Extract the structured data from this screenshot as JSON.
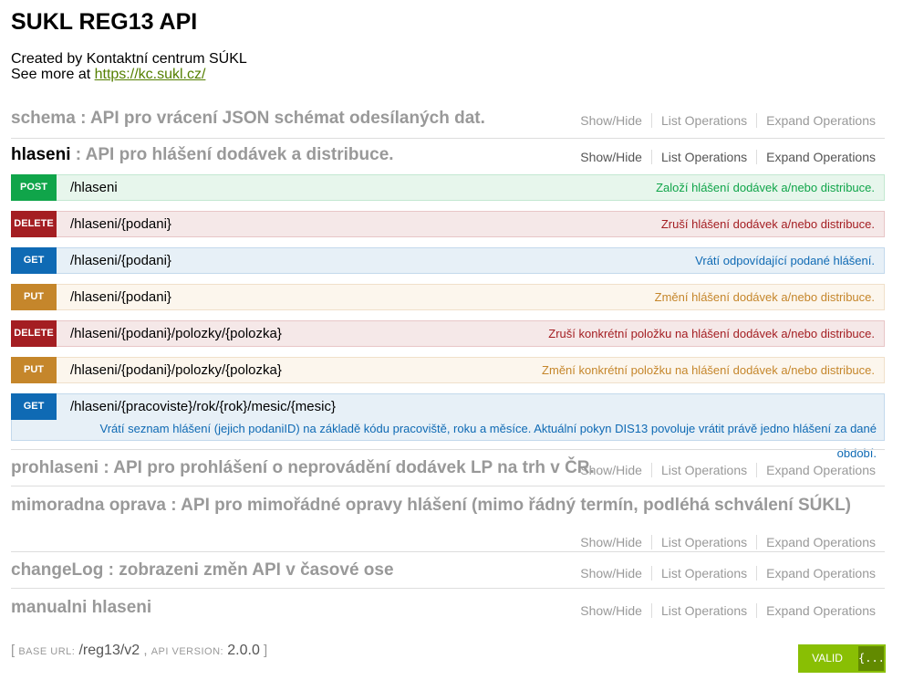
{
  "title": "SUKL REG13 API",
  "info": {
    "created_by": "Created by Kontaktní centrum SÚKL",
    "see_more_prefix": "See more at ",
    "link_text": "https://kc.sukl.cz/"
  },
  "ops_labels": {
    "show_hide": "Show/Hide",
    "list": "List Operations",
    "expand": "Expand Operations"
  },
  "resources": {
    "schema": {
      "name": "schema",
      "desc": ": API pro vrácení JSON schémat odesílaných dat."
    },
    "hlaseni": {
      "name": "hlaseni",
      "desc": ": API pro hlášení dodávek a distribuce."
    },
    "prohlaseni": {
      "name": "prohlaseni",
      "desc": ": API pro prohlášení o neprovádění dodávek LP na trh v ČR."
    },
    "mimoradna": {
      "name": "mimoradna oprava",
      "desc": ": API pro mimořádné opravy hlášení (mimo řádný termín, podléhá schválení SÚKL)"
    },
    "changelog": {
      "name": "changeLog",
      "desc": ": zobrazeni změn API v časové ose"
    },
    "manualni": {
      "name": "manualni hlaseni",
      "desc": ""
    }
  },
  "endpoints": [
    {
      "method": "POST",
      "path": "/hlaseni",
      "summary": "Založí hlášení dodávek a/nebo distribuce."
    },
    {
      "method": "DELETE",
      "path": "/hlaseni/{podani}",
      "summary": "Zruší hlášení dodávek a/nebo distribuce."
    },
    {
      "method": "GET",
      "path": "/hlaseni/{podani}",
      "summary": "Vrátí odpovídající podané hlášení."
    },
    {
      "method": "PUT",
      "path": "/hlaseni/{podani}",
      "summary": "Změní hlášení dodávek a/nebo distribuce."
    },
    {
      "method": "DELETE",
      "path": "/hlaseni/{podani}/polozky/{polozka}",
      "summary": "Zruší konkrétní položku na hlášení dodávek a/nebo distribuce."
    },
    {
      "method": "PUT",
      "path": "/hlaseni/{podani}/polozky/{polozka}",
      "summary": "Změní konkrétní položku na hlášení dodávek a/nebo distribuce."
    },
    {
      "method": "GET",
      "path": "/hlaseni/{pracoviste}/rok/{rok}/mesic/{mesic}",
      "summary": "Vrátí seznam hlášení (jejich podaniID) na základě kódu pracoviště, roku a měsíce. Aktuální pokyn DIS13 povoluje vrátit právě jedno hlášení za dané období."
    }
  ],
  "footer": {
    "open_bracket": "[",
    "base_url_label": "BASE URL:",
    "base_url": "/reg13/v2",
    "separator": ",",
    "api_version_label": "API VERSION:",
    "api_version": "2.0.0",
    "close_bracket": "]"
  },
  "validator": {
    "label": "VALID",
    "icon": "{...}"
  },
  "colors": {
    "post": "#10a54a",
    "delete": "#a41e22",
    "get": "#0f6ab4",
    "put": "#c5862b",
    "link": "#547f00",
    "valid": "#89bf04"
  }
}
